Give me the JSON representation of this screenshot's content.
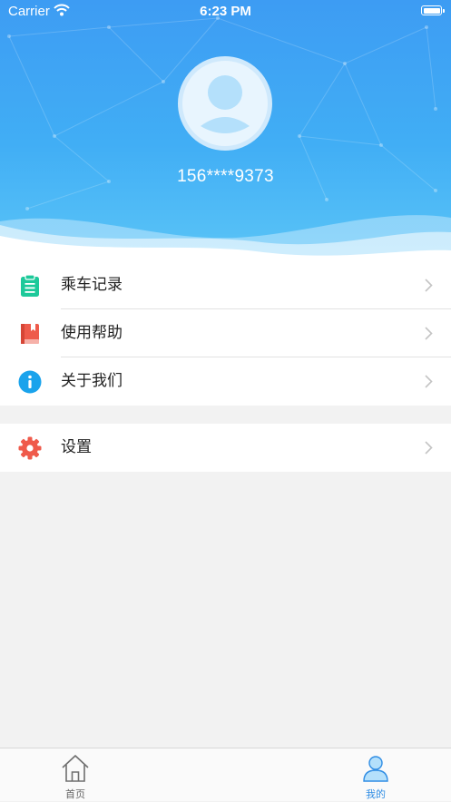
{
  "status_bar": {
    "carrier": "Carrier",
    "time": "6:23 PM"
  },
  "profile": {
    "phone": "156****9373"
  },
  "menu_group_1": [
    {
      "label": "乘车记录",
      "icon": "clipboard-icon",
      "color": "#1dc99a"
    },
    {
      "label": "使用帮助",
      "icon": "book-icon",
      "color": "#ee5b4b"
    },
    {
      "label": "关于我们",
      "icon": "info-icon",
      "color": "#1aa3ec"
    }
  ],
  "menu_group_2": [
    {
      "label": "设置",
      "icon": "gear-icon",
      "color": "#ef5a4b"
    }
  ],
  "tabbar": {
    "tabs": [
      {
        "label": "首页",
        "icon": "home-icon",
        "active": false
      },
      {
        "label": "我的",
        "icon": "user-icon",
        "active": true
      }
    ],
    "active_color": "#2f8de4",
    "inactive_color": "#666666"
  },
  "colors": {
    "header_blue": "#3d9cf3",
    "background": "#f2f2f2"
  }
}
